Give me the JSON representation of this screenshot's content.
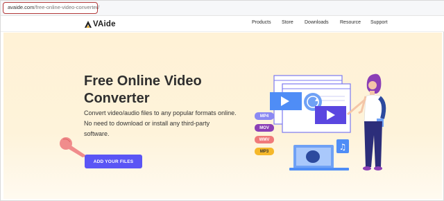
{
  "browser": {
    "url_domain": "avaide.com",
    "url_path": "/free-online-video-converter/"
  },
  "header": {
    "logo_text": "VAide",
    "nav": [
      "Products",
      "Store",
      "Downloads",
      "Resource",
      "Support"
    ]
  },
  "hero": {
    "title": "Free Online Video Converter",
    "description": "Convert video/audio files to any popular formats online. No need to download or install any third-party software.",
    "button_label": "ADD YOUR FILES",
    "formats": [
      "MP4",
      "MOV",
      "WMV",
      "MP3"
    ]
  },
  "colors": {
    "accent": "#5a55f5",
    "highlight_border": "#b33a3a",
    "hero_bg": "#fff2d6"
  }
}
